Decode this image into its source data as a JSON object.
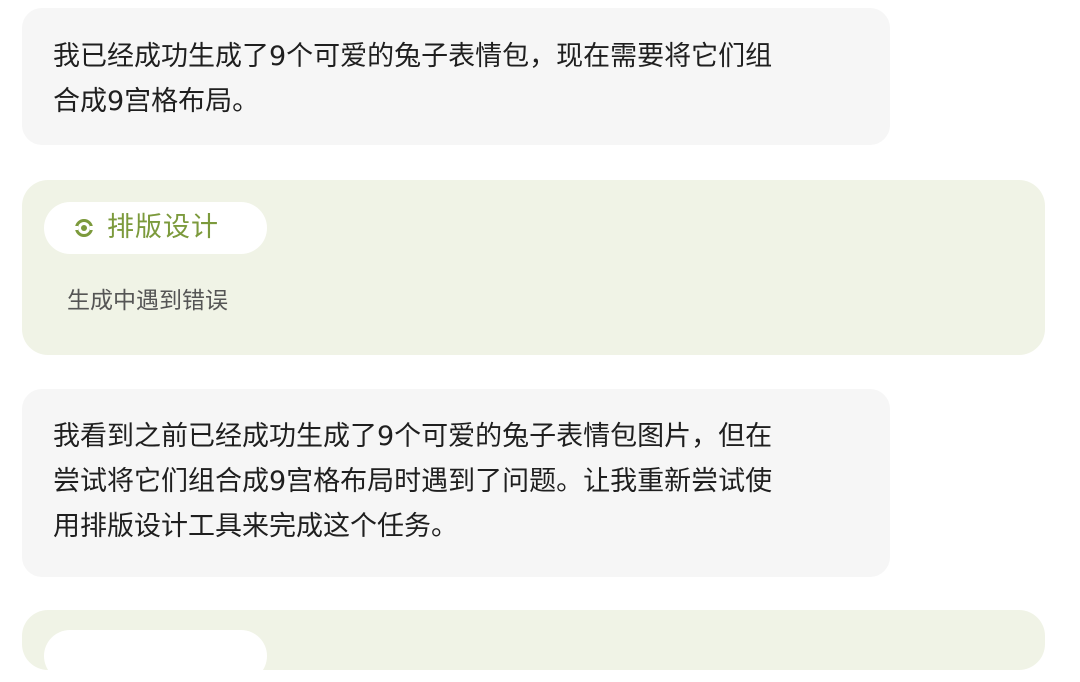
{
  "messages": [
    {
      "lines": [
        "我已经成功生成了9个可爱的兔子表情包，现在需要将它们组",
        "合成9宫格布局。"
      ]
    },
    {
      "lines": [
        "我看到之前已经成功生成了9个可爱的兔子表情包图片，但在",
        "尝试将它们组合成9宫格布局时遇到了问题。让我重新尝试使",
        "用排版设计工具来完成这个任务。"
      ]
    }
  ],
  "tool_calls": [
    {
      "icon": "layout-tool-icon",
      "label": "排版设计",
      "status": "生成中遇到错误"
    }
  ],
  "colors": {
    "message_bg": "#f6f6f6",
    "tool_card_bg": "#f0f3e6",
    "tool_label": "#7c9a3c",
    "status_text": "#555555"
  }
}
